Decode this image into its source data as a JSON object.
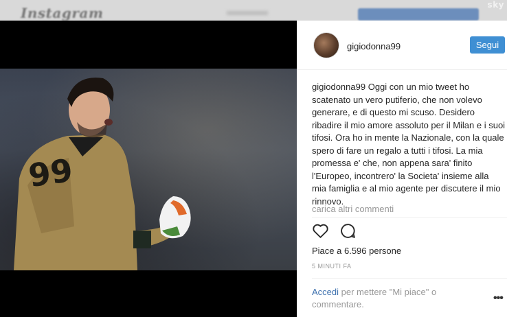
{
  "header": {
    "logo": "Instagram",
    "watermark": "sky"
  },
  "post": {
    "username": "gigiodonna99",
    "follow_label": "Segui",
    "caption_user": "gigiodonna99",
    "caption_text": "Oggi con un mio tweet ho scatenato un vero putiferio, che non volevo generare, e di questo mi scuso. Desidero ribadire il mio amore assoluto per il Milan e i suoi tifosi. Ora ho in mente la Nazionale, con la quale spero di fare un regalo a tutti i tifosi. La mia promessa e' che, non appena sara' finito l'Europeo, incontrero' la Societa' insieme alla mia famiglia e al mio agente per discutere il mio rinnovo.",
    "load_more": "carica altri commenti",
    "likes": "Piace a 6.596 persone",
    "time": "5 MINUTI FA",
    "login_link": "Accedi",
    "login_text": " per mettere \"Mi piace\" o commentare.",
    "options": "•••"
  },
  "icons": {
    "like": "heart-icon",
    "comment": "comment-icon",
    "more": "more-options-icon"
  },
  "colors": {
    "accent": "#3f8fd3",
    "link": "#3f72af",
    "muted": "#999999"
  }
}
